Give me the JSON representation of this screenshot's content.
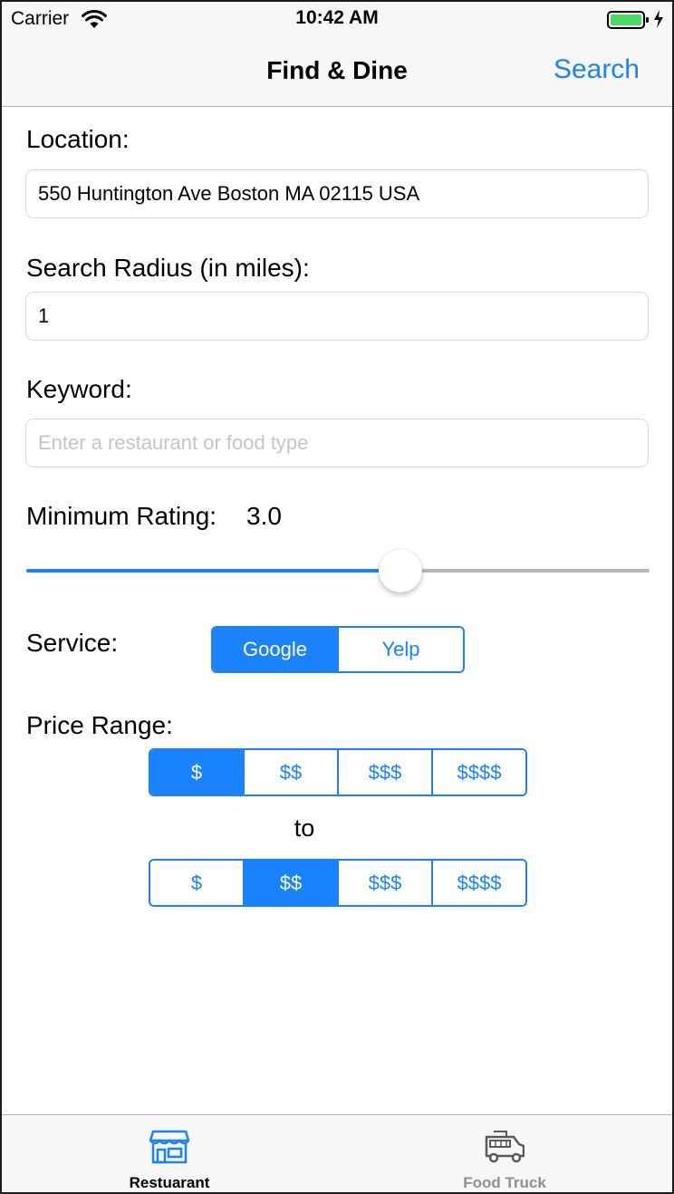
{
  "status_bar": {
    "carrier": "Carrier",
    "time": "10:42 AM"
  },
  "nav": {
    "title": "Find & Dine",
    "search_label": "Search"
  },
  "form": {
    "location_label": "Location:",
    "location_value": "550 Huntington Ave Boston MA 02115 USA",
    "radius_label": "Search Radius (in miles):",
    "radius_value": "1",
    "keyword_label": "Keyword:",
    "keyword_placeholder": "Enter a restaurant or food type",
    "rating_label": "Minimum Rating:",
    "rating_value": "3.0",
    "rating_fraction": 0.6,
    "service_label": "Service:",
    "service_options": [
      "Google",
      "Yelp"
    ],
    "service_selected": 0,
    "price_label": "Price Range:",
    "price_from_options": [
      "$",
      "$$",
      "$$$",
      "$$$$"
    ],
    "price_from_selected": 0,
    "to_label": "to",
    "price_to_options": [
      "$",
      "$$",
      "$$$",
      "$$$$"
    ],
    "price_to_selected": 1
  },
  "tabs": [
    {
      "label": "Restuarant",
      "icon": "storefront-icon",
      "active": true
    },
    {
      "label": "Food Truck",
      "icon": "food-truck-icon",
      "active": false
    }
  ],
  "colors": {
    "accent": "#1a82fb",
    "inactive": "#8e8e93"
  }
}
